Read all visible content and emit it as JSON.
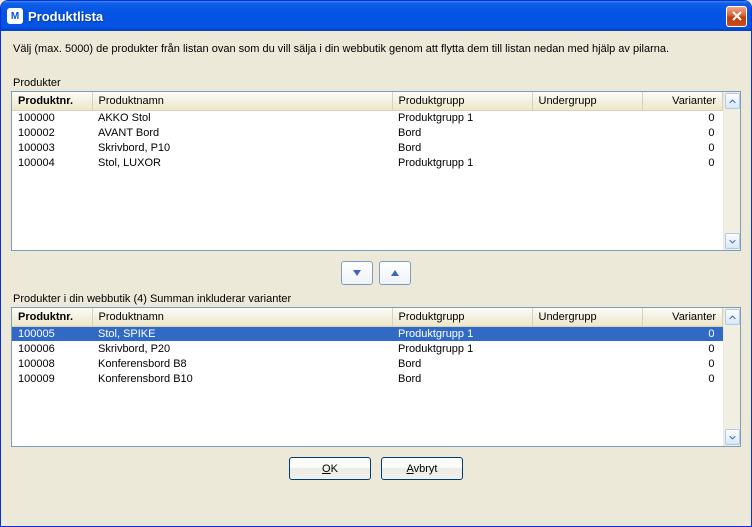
{
  "window": {
    "title": "Produktlista"
  },
  "instruction": "Välj (max. 5000) de produkter från listan ovan som du vill sälja i din webbutik genom att flytta dem till listan nedan med hjälp av pilarna.",
  "labels": {
    "products": "Produkter",
    "webshop_products": "Produkter i din webbutik (4) Summan inkluderar varianter"
  },
  "columns": {
    "nr": "Produktnr.",
    "name": "Produktnamn",
    "group": "Produktgrupp",
    "subgroup": "Undergrupp",
    "variants": "Varianter"
  },
  "top_rows": [
    {
      "nr": "100000",
      "name": "AKKO Stol",
      "group": "Produktgrupp 1",
      "subgroup": "",
      "variants": "0"
    },
    {
      "nr": "100002",
      "name": "AVANT Bord",
      "group": "Bord",
      "subgroup": "",
      "variants": "0"
    },
    {
      "nr": "100003",
      "name": "Skrivbord, P10",
      "group": "Bord",
      "subgroup": "",
      "variants": "0"
    },
    {
      "nr": "100004",
      "name": "Stol, LUXOR",
      "group": "Produktgrupp 1",
      "subgroup": "",
      "variants": "0"
    }
  ],
  "bottom_rows": [
    {
      "nr": "100005",
      "name": "Stol, SPIKE",
      "group": "Produktgrupp 1",
      "subgroup": "",
      "variants": "0",
      "selected": true
    },
    {
      "nr": "100006",
      "name": "Skrivbord, P20",
      "group": "Produktgrupp 1",
      "subgroup": "",
      "variants": "0"
    },
    {
      "nr": "100008",
      "name": "Konferensbord B8",
      "group": "Bord",
      "subgroup": "",
      "variants": "0"
    },
    {
      "nr": "100009",
      "name": "Konferensbord B10",
      "group": "Bord",
      "subgroup": "",
      "variants": "0"
    }
  ],
  "buttons": {
    "ok": "OK",
    "cancel": "Avbryt"
  }
}
